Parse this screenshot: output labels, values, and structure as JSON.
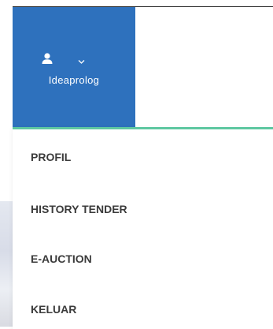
{
  "user_menu": {
    "username": "Ideaprolog",
    "user_icon": "user-icon",
    "toggle_icon": "chevron-down-icon",
    "background_color": "#2e71bd",
    "accent_color": "#5ec7a1"
  },
  "dropdown": {
    "items": [
      {
        "label": "PROFIL"
      },
      {
        "label": "HISTORY TENDER"
      },
      {
        "label": "E-AUCTION"
      },
      {
        "label": "KELUAR"
      }
    ]
  }
}
